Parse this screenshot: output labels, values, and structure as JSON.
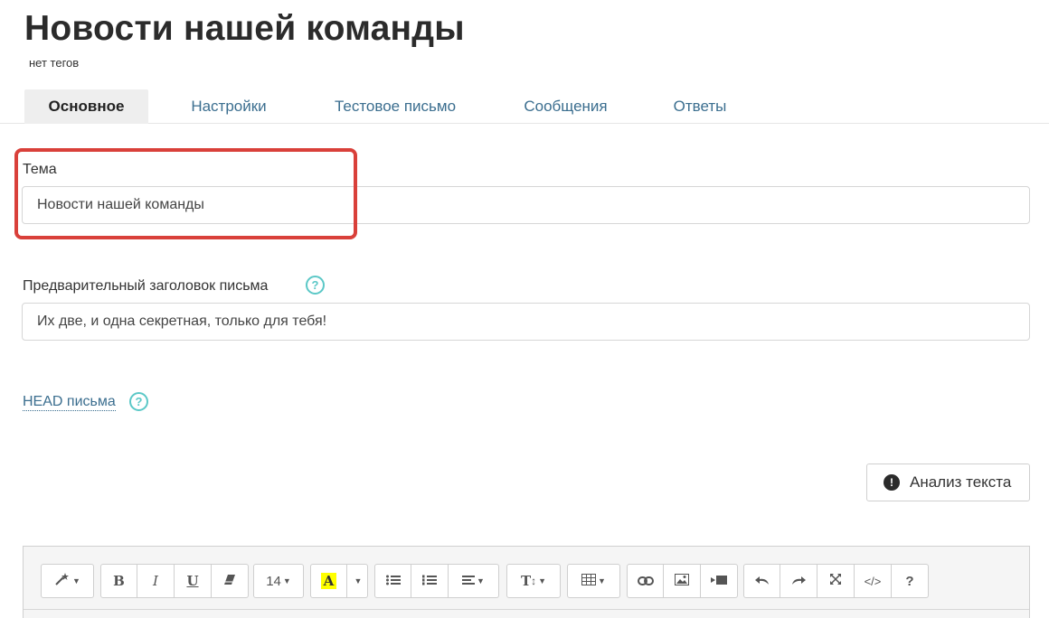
{
  "page": {
    "title": "Новости нашей команды",
    "tags": "нет тегов"
  },
  "tabs": [
    {
      "label": "Основное",
      "active": true
    },
    {
      "label": "Настройки",
      "active": false
    },
    {
      "label": "Тестовое письмо",
      "active": false
    },
    {
      "label": "Сообщения",
      "active": false
    },
    {
      "label": "Ответы",
      "active": false
    }
  ],
  "form": {
    "subject_label": "Тема",
    "subject_value": "Новости нашей команды",
    "preheader_label": "Предварительный заголовок письма",
    "preheader_value": "Их две, и одна секретная, только для тебя!",
    "head_link": "HEAD письма",
    "help_glyph": "?"
  },
  "analysis_button": {
    "label": "Анализ текста",
    "icon": "exclamation-circle-icon",
    "icon_glyph": "!"
  },
  "editor_toolbar": {
    "bold": "B",
    "italic": "I",
    "underline": "U",
    "font_size": "14",
    "highlight_letter": "A",
    "text_size_glyph": "T",
    "help": "?",
    "code": "</>"
  },
  "colors": {
    "accent_link": "#3b6e8f",
    "help_icon": "#5bc8c7",
    "highlight_frame": "#d9403a",
    "active_tab_bg": "#eeeeee",
    "text_highlight": "#ffff00"
  }
}
